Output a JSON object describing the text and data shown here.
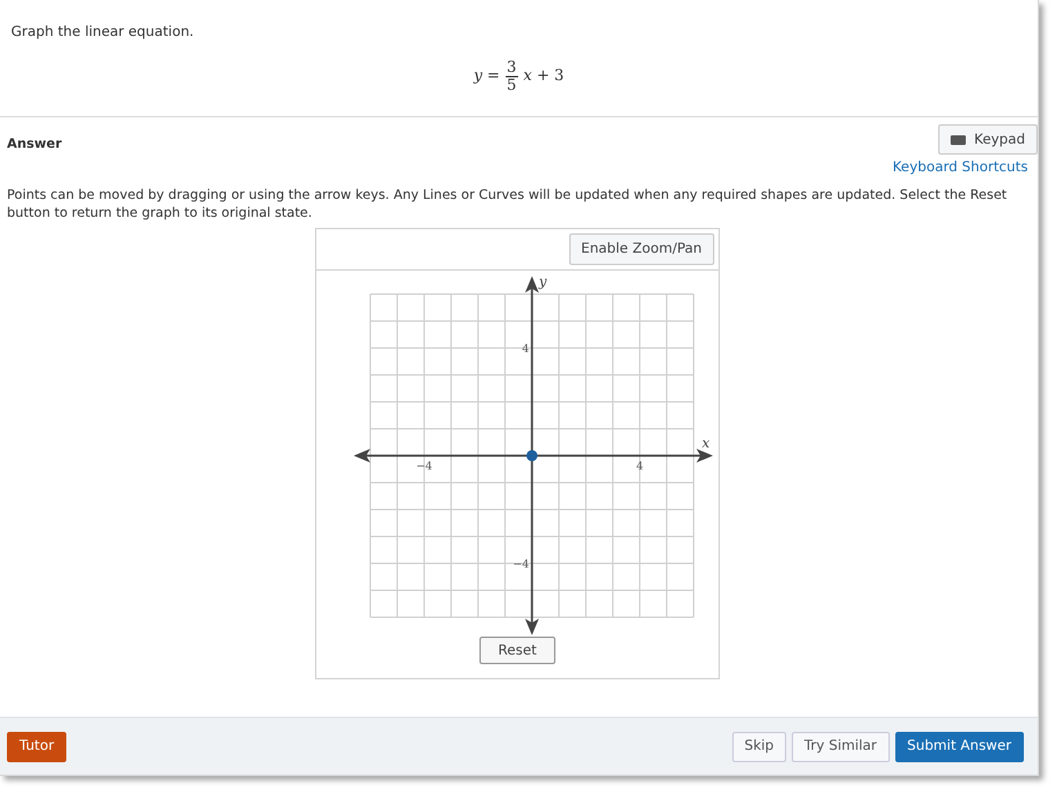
{
  "question": {
    "prompt": "Graph the linear equation.",
    "lhs": "*y* =",
    "numerator": "3",
    "denominator": "5",
    "rest": "*x* + 3"
  },
  "answer": {
    "heading": "Answer",
    "keypad_button": "Keypad",
    "shortcuts_link": "Keyboard Shortcuts",
    "instructions": "Points can be moved by dragging or using the arrow keys. Any Lines or Curves will be updated when any required shapes are updated. Select the Reset button to return the graph to its original state."
  },
  "graph": {
    "zoom_button": "Enable Zoom/Pan",
    "reset_button": "Reset",
    "chart_data": {
      "type": "scatter",
      "xlabel": "x",
      "ylabel": "y",
      "xlim": [
        -6,
        6
      ],
      "ylim": [
        -6,
        6
      ],
      "xticks": [
        {
          "value": -4,
          "label": "−4"
        },
        {
          "value": 4,
          "label": "4"
        }
      ],
      "yticks": [
        {
          "value": -4,
          "label": "−4"
        },
        {
          "value": 4,
          "label": "4"
        }
      ],
      "grid": true,
      "series": [
        {
          "color": "#1f5f9e",
          "x": [
            0
          ],
          "values": [
            0
          ]
        }
      ]
    }
  },
  "footer": {
    "tutor_button": "Tutor",
    "skip_button": "Skip",
    "try_similar_button": "Try Similar",
    "submit_button": "Submit Answer"
  }
}
